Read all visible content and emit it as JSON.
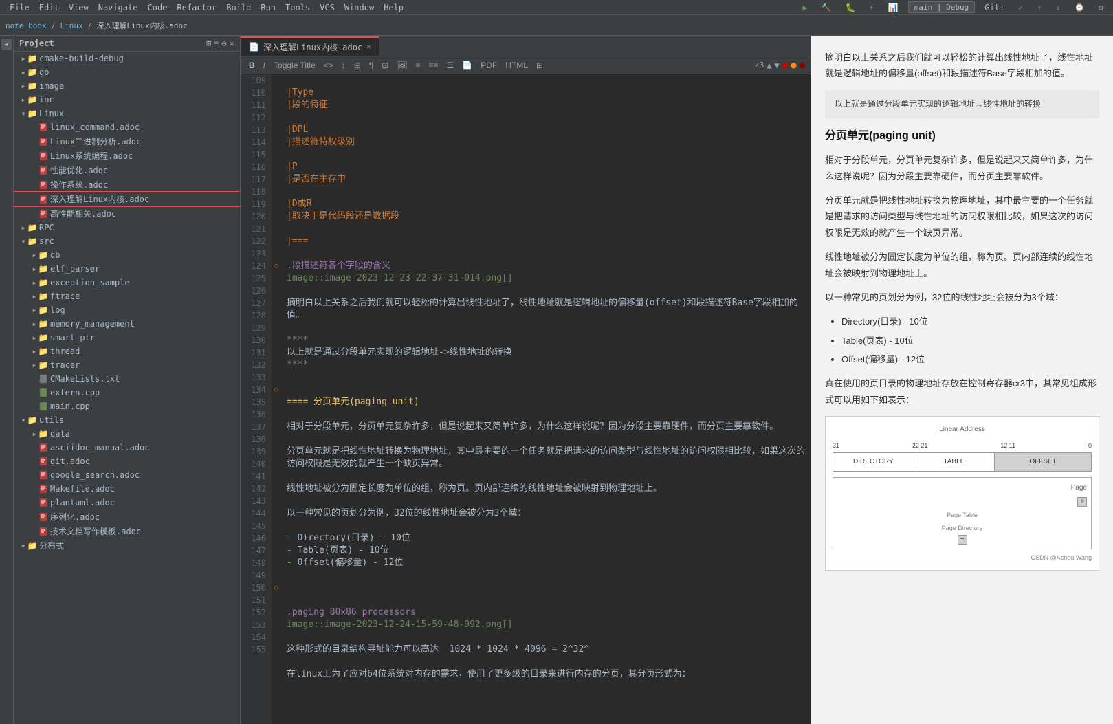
{
  "menu": {
    "items": [
      "File",
      "Edit",
      "View",
      "Navigate",
      "Code",
      "Refactor",
      "Build",
      "Run",
      "Tools",
      "VCS",
      "Window",
      "Help"
    ]
  },
  "breadcrumb": {
    "items": [
      "note_book",
      "Linux",
      "深入理解Linux内核.adoc"
    ]
  },
  "toolbar": {
    "branch": "main | Debug",
    "git_label": "Git:"
  },
  "tabs": [
    {
      "label": "深入理解Linux内核.adoc",
      "active": true,
      "icon": "📄"
    }
  ],
  "editor_toolbar": {
    "buttons": [
      "B",
      "I",
      "Toggle Title",
      "<>",
      "↕",
      "⊞",
      "¶",
      "⊡",
      "🖼",
      "≡",
      "≡≡",
      "☰",
      "📄",
      "PDF",
      "HTML",
      "⊞"
    ]
  },
  "sidebar": {
    "title": "Project",
    "items": [
      {
        "type": "folder",
        "label": "cmake-build-debug",
        "level": 1,
        "expanded": false
      },
      {
        "type": "folder",
        "label": "go",
        "level": 1,
        "expanded": false
      },
      {
        "type": "folder",
        "label": "image",
        "level": 1,
        "expanded": false
      },
      {
        "type": "folder",
        "label": "inc",
        "level": 1,
        "expanded": false
      },
      {
        "type": "folder",
        "label": "Linux",
        "level": 1,
        "expanded": true
      },
      {
        "type": "file",
        "label": "linux_command.adoc",
        "level": 2
      },
      {
        "type": "file",
        "label": "Linux二进制分析.adoc",
        "level": 2
      },
      {
        "type": "file",
        "label": "Linux系统编程.adoc",
        "level": 2
      },
      {
        "type": "file",
        "label": "性能优化.adoc",
        "level": 2
      },
      {
        "type": "file",
        "label": "操作系统.adoc",
        "level": 2
      },
      {
        "type": "file",
        "label": "深入理解Linux内核.adoc",
        "level": 2,
        "selected": true
      },
      {
        "type": "file",
        "label": "高性能相关.adoc",
        "level": 2
      },
      {
        "type": "folder",
        "label": "RPC",
        "level": 1,
        "expanded": false
      },
      {
        "type": "folder",
        "label": "src",
        "level": 1,
        "expanded": true
      },
      {
        "type": "folder",
        "label": "db",
        "level": 2,
        "expanded": false
      },
      {
        "type": "folder",
        "label": "elf_parser",
        "level": 2,
        "expanded": false
      },
      {
        "type": "folder",
        "label": "exception_sample",
        "level": 2,
        "expanded": false
      },
      {
        "type": "folder",
        "label": "ftrace",
        "level": 2,
        "expanded": false
      },
      {
        "type": "folder",
        "label": "log",
        "level": 2,
        "expanded": false
      },
      {
        "type": "folder",
        "label": "memory_management",
        "level": 2,
        "expanded": false
      },
      {
        "type": "folder",
        "label": "smart_ptr",
        "level": 2,
        "expanded": false
      },
      {
        "type": "folder",
        "label": "thread",
        "level": 2,
        "expanded": false
      },
      {
        "type": "folder",
        "label": "tracer",
        "level": 2,
        "expanded": false
      },
      {
        "type": "file",
        "label": "CMakeLists.txt",
        "level": 2
      },
      {
        "type": "file",
        "label": "extern.cpp",
        "level": 2
      },
      {
        "type": "file",
        "label": "main.cpp",
        "level": 2
      },
      {
        "type": "folder",
        "label": "utils",
        "level": 1,
        "expanded": true
      },
      {
        "type": "folder",
        "label": "data",
        "level": 2,
        "expanded": false
      },
      {
        "type": "file",
        "label": "asciidoc_manual.adoc",
        "level": 2
      },
      {
        "type": "file",
        "label": "git.adoc",
        "level": 2
      },
      {
        "type": "file",
        "label": "google_search.adoc",
        "level": 2
      },
      {
        "type": "file",
        "label": "Makefile.adoc",
        "level": 2
      },
      {
        "type": "file",
        "label": "plantuml.adoc",
        "level": 2
      },
      {
        "type": "file",
        "label": "序列化.adoc",
        "level": 2
      },
      {
        "type": "file",
        "label": "技术文档写作模板.adoc",
        "level": 2
      },
      {
        "type": "folder",
        "label": "分布式",
        "level": 1,
        "expanded": false
      }
    ]
  },
  "editor": {
    "lines": [
      {
        "num": 109,
        "content": ""
      },
      {
        "num": 110,
        "content": "|Type"
      },
      {
        "num": 111,
        "content": "|段的特征"
      },
      {
        "num": 112,
        "content": ""
      },
      {
        "num": 113,
        "content": "|DPL"
      },
      {
        "num": 114,
        "content": "|描述符特权级别"
      },
      {
        "num": 115,
        "content": ""
      },
      {
        "num": 116,
        "content": "|P"
      },
      {
        "num": 117,
        "content": "|是否在主存中"
      },
      {
        "num": 118,
        "content": ""
      },
      {
        "num": 119,
        "content": "|D或B"
      },
      {
        "num": 120,
        "content": "|取决于是代码段还是数据段"
      },
      {
        "num": 121,
        "content": ""
      },
      {
        "num": 122,
        "content": "|==="
      },
      {
        "num": 123,
        "content": ""
      },
      {
        "num": 124,
        "content": ".段描述符各个字段的含义"
      },
      {
        "num": 125,
        "content": "image::image-2023-12-23-22-37-31-014.png[]"
      },
      {
        "num": 126,
        "content": ""
      },
      {
        "num": 127,
        "content": "摘明白以上关系之后我们就可以轻松的计算出线性地址了，线性地址就是逻辑地址的偏移量(offset)和段描述符Base字段相加的值。"
      },
      {
        "num": 128,
        "content": ""
      },
      {
        "num": 129,
        "content": "****"
      },
      {
        "num": 130,
        "content": "以上就是通过分段单元实现的逻辑地址->线性地址的转换"
      },
      {
        "num": 131,
        "content": "****"
      },
      {
        "num": 132,
        "content": ""
      },
      {
        "num": 133,
        "content": ""
      },
      {
        "num": 134,
        "content": "==== 分页单元(paging unit)"
      },
      {
        "num": 135,
        "content": ""
      },
      {
        "num": 136,
        "content": "相对于分段单元，分页单元复杂许多，但是说起来又简单许多，为什么这样说呢？因为分段主要靠硬件，而分页主要靠软件。"
      },
      {
        "num": 137,
        "content": ""
      },
      {
        "num": 138,
        "content": "分页单元就是把线性地址转换为物理地址，其中最主要的一个任务就是把请求的访问类型与线性地址的访问权限相比较，如果这次的访问权限是无效的就产生一个缺页异常。"
      },
      {
        "num": 139,
        "content": ""
      },
      {
        "num": 140,
        "content": "线性地址被分为固定长度为单位的组，称为页。页内部连续的线性地址会被映射到物理地址上。"
      },
      {
        "num": 141,
        "content": ""
      },
      {
        "num": 142,
        "content": "以一种常见的页划分为例，32位的线性地址会被分为3个域："
      },
      {
        "num": 143,
        "content": ""
      },
      {
        "num": 144,
        "content": "- Directory(目录) - 10位"
      },
      {
        "num": 145,
        "content": "- Table(页表) - 10位"
      },
      {
        "num": 146,
        "content": "- Offset(偏移量) - 12位"
      },
      {
        "num": 147,
        "content": ""
      },
      {
        "num": 148,
        "content": ""
      },
      {
        "num": 149,
        "content": ""
      },
      {
        "num": 150,
        "content": ".paging 80x86 processors"
      },
      {
        "num": 151,
        "content": "image::image-2023-12-24-15-59-48-992.png[]"
      },
      {
        "num": 152,
        "content": ""
      },
      {
        "num": 153,
        "content": "这种形式的目录结构寻址能力可以高达  1024 * 1024 * 4096 = 2^32^"
      },
      {
        "num": 154,
        "content": ""
      },
      {
        "num": 155,
        "content": "在linux上为了应对64位系统对内存的需求，使用了更多级的目录来进行内存的分页，其分页形式为："
      }
    ]
  },
  "preview": {
    "intro_text": "摘明白以上关系之后我们就可以轻松的计算出线性地址了，线性地址就是逻辑地址的偏移量(offset)和段描述符Base字段相加的值。",
    "callout_text": "以上就是通过分段单元实现的逻辑地址→线性地址的转换",
    "section_title": "分页单元(paging unit)",
    "para1": "相对于分段单元，分页单元复杂许多，但是说起来又简单许多，为什么这样说呢？因为分段主要靠硬件，而分页主要靠软件。",
    "para2": "分页单元就是把线性地址转换为物理地址，其中最主要的一个任务就是把请求的访问类型与线性地址的访问权限相比较，如果这次的访问权限是无效的就产生一个缺页异常。",
    "para3": "线性地址被分为固定长度为单位的组，称为页。页内部连续的线性地址会被映射到物理地址上。",
    "para4": "以一种常见的页划分为例，32位的线性地址会被分为3个域：",
    "list": [
      "Directory(目录) - 10位",
      "Table(页表) - 10位",
      "Offset(偏移量) - 12位"
    ],
    "para5": "真在使用的页目录的物理地址存放在控制寄存器cr3中，其常见组成形式可以用如下如表示：",
    "diagram_title": "Linear Address",
    "diagram_labels": [
      "31",
      "22",
      "21",
      "12",
      "11",
      "0"
    ],
    "diagram_boxes": [
      "DIRECTORY",
      "TABLE",
      "OFFSET"
    ],
    "page_label": "Page",
    "watermark": "CSDN @Achou.Wang"
  }
}
